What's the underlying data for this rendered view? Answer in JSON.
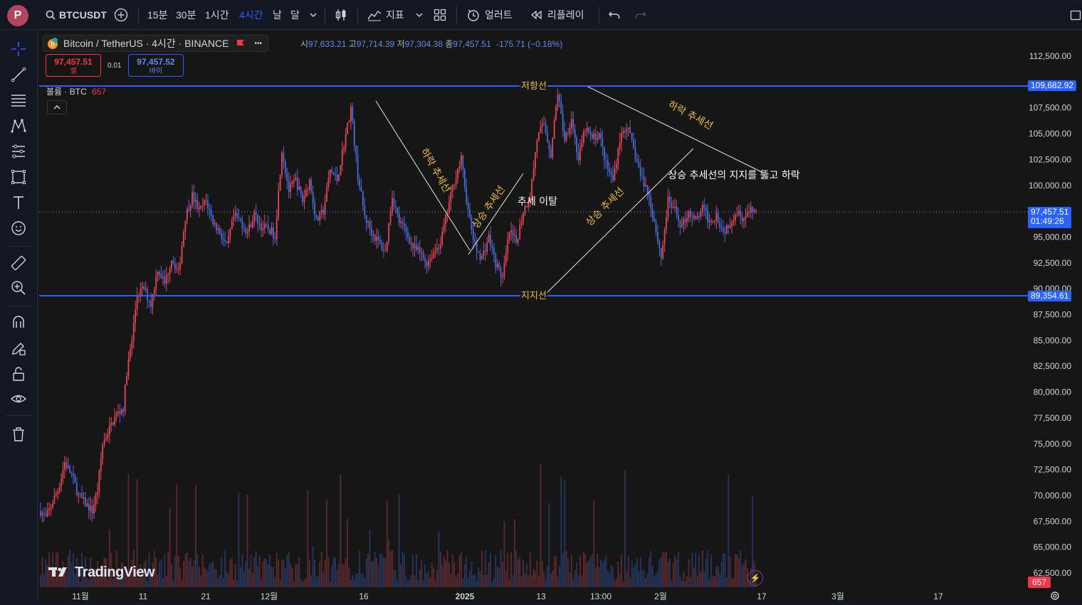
{
  "topbar": {
    "avatar_letter": "P",
    "symbol": "BTCUSDT",
    "intervals": [
      "15분",
      "30분",
      "1시간",
      "4시간",
      "날",
      "달"
    ],
    "active_interval": "4시간",
    "indicators_label": "지표",
    "alert_label": "얼러트",
    "replay_label": "리플레이"
  },
  "legend": {
    "title": "Bitcoin / TetherUS · 4시간 · BINANCE",
    "more": "•••"
  },
  "ohlc": {
    "open_label": "시",
    "open": "97,633.21",
    "high_label": "고",
    "high": "97,714.39",
    "low_label": "저",
    "low": "97,304.38",
    "close_label": "종",
    "close": "97,457.51",
    "change": "-175.71 (−0.18%)"
  },
  "trade": {
    "sell_price": "97,457.51",
    "sell_label": "셀",
    "spread": "0.01",
    "buy_price": "97,457.52",
    "buy_label": "바이"
  },
  "volume_legend": {
    "label": "볼륨 · BTC",
    "value": "657"
  },
  "colors": {
    "up": "#e5475a",
    "down": "#4a6bd8",
    "line": "#2962ff",
    "annot": "#f0c02e"
  },
  "chart_data": {
    "type": "candlestick",
    "symbol": "Bitcoin / TetherUS",
    "exchange": "BINANCE",
    "timeframe": "4시간",
    "y_ticks": [
      112500,
      107500,
      105000,
      102500,
      100000,
      95000,
      92500,
      90000,
      87500,
      85000,
      82500,
      80000,
      77500,
      75000,
      72500,
      70000,
      67500,
      65000,
      62500
    ],
    "y_tick_labels": [
      "112,500.00",
      "107,500.00",
      "105,000.00",
      "102,500.00",
      "100,000.00",
      "95,000.00",
      "92,500.00",
      "90,000.00",
      "87,500.00",
      "85,000.00",
      "82,500.00",
      "80,000.00",
      "77,500.00",
      "75,000.00",
      "72,500.00",
      "70,000.00",
      "67,500.00",
      "65,000.00",
      "62,500.00"
    ],
    "x_ticks": [
      "11월",
      "11",
      "21",
      "12월",
      "16",
      "2025",
      "13",
      "13:00",
      "2월",
      "17",
      "3월",
      "17"
    ],
    "path_points": [
      [
        0,
        68500
      ],
      [
        3,
        67800
      ],
      [
        6,
        69000
      ],
      [
        10,
        70500
      ],
      [
        14,
        73200
      ],
      [
        18,
        72000
      ],
      [
        22,
        70000
      ],
      [
        26,
        69200
      ],
      [
        30,
        68500
      ],
      [
        33,
        70500
      ],
      [
        36,
        75000
      ],
      [
        40,
        76500
      ],
      [
        44,
        77800
      ],
      [
        48,
        78500
      ],
      [
        50,
        82000
      ],
      [
        53,
        85000
      ],
      [
        56,
        89500
      ],
      [
        60,
        90000
      ],
      [
        64,
        88500
      ],
      [
        68,
        92000
      ],
      [
        72,
        90500
      ],
      [
        76,
        93000
      ],
      [
        80,
        91500
      ],
      [
        84,
        97000
      ],
      [
        88,
        99000
      ],
      [
        92,
        97500
      ],
      [
        96,
        98500
      ],
      [
        100,
        96500
      ],
      [
        104,
        95500
      ],
      [
        108,
        94000
      ],
      [
        112,
        97000
      ],
      [
        116,
        96500
      ],
      [
        120,
        95500
      ],
      [
        124,
        97200
      ],
      [
        128,
        96000
      ],
      [
        132,
        95800
      ],
      [
        136,
        95200
      ],
      [
        140,
        103500
      ],
      [
        144,
        99500
      ],
      [
        148,
        100500
      ],
      [
        152,
        98500
      ],
      [
        156,
        100500
      ],
      [
        160,
        96500
      ],
      [
        164,
        97500
      ],
      [
        168,
        101500
      ],
      [
        172,
        100500
      ],
      [
        176,
        104000
      ],
      [
        180,
        107500
      ],
      [
        184,
        101000
      ],
      [
        188,
        97000
      ],
      [
        192,
        95500
      ],
      [
        196,
        94500
      ],
      [
        200,
        93500
      ],
      [
        204,
        99000
      ],
      [
        208,
        96500
      ],
      [
        212,
        95500
      ],
      [
        216,
        94000
      ],
      [
        220,
        93500
      ],
      [
        224,
        92500
      ],
      [
        228,
        93500
      ],
      [
        232,
        94500
      ],
      [
        236,
        97500
      ],
      [
        240,
        100500
      ],
      [
        244,
        102500
      ],
      [
        248,
        97500
      ],
      [
        252,
        94000
      ],
      [
        256,
        93000
      ],
      [
        260,
        95000
      ],
      [
        264,
        92500
      ],
      [
        268,
        91000
      ],
      [
        272,
        95500
      ],
      [
        276,
        94500
      ],
      [
        280,
        97500
      ],
      [
        284,
        99000
      ],
      [
        288,
        104500
      ],
      [
        292,
        106000
      ],
      [
        296,
        103000
      ],
      [
        300,
        109000
      ],
      [
        304,
        104500
      ],
      [
        308,
        106500
      ],
      [
        312,
        102500
      ],
      [
        316,
        105500
      ],
      [
        320,
        104500
      ],
      [
        324,
        105000
      ],
      [
        328,
        102000
      ],
      [
        332,
        100500
      ],
      [
        336,
        104500
      ],
      [
        340,
        105800
      ],
      [
        344,
        103500
      ],
      [
        348,
        101000
      ],
      [
        352,
        99500
      ],
      [
        356,
        96500
      ],
      [
        360,
        93000
      ],
      [
        364,
        98500
      ],
      [
        368,
        97500
      ],
      [
        372,
        96000
      ],
      [
        376,
        97500
      ],
      [
        380,
        96500
      ],
      [
        384,
        97800
      ],
      [
        388,
        96500
      ],
      [
        392,
        97200
      ],
      [
        396,
        95500
      ],
      [
        400,
        96500
      ],
      [
        404,
        97500
      ],
      [
        408,
        96800
      ],
      [
        412,
        97500
      ],
      [
        415,
        97457.51
      ]
    ],
    "volume_last": 657,
    "last_price": "97,457.51",
    "countdown": "01:49:26",
    "resistance": {
      "label": "저항선",
      "value": "109,682.92"
    },
    "support": {
      "label": "지지선",
      "value": "89,354.61"
    },
    "annotations": {
      "down_trend_1": "하락 추세선",
      "up_trend_1": "상승 추세선",
      "trend_break": "추세 이탈",
      "up_trend_2": "상승 추세선",
      "down_trend_2": "하락 추세선",
      "break_note": "상승 추세선의 지지를 뚫고 하락"
    }
  }
}
